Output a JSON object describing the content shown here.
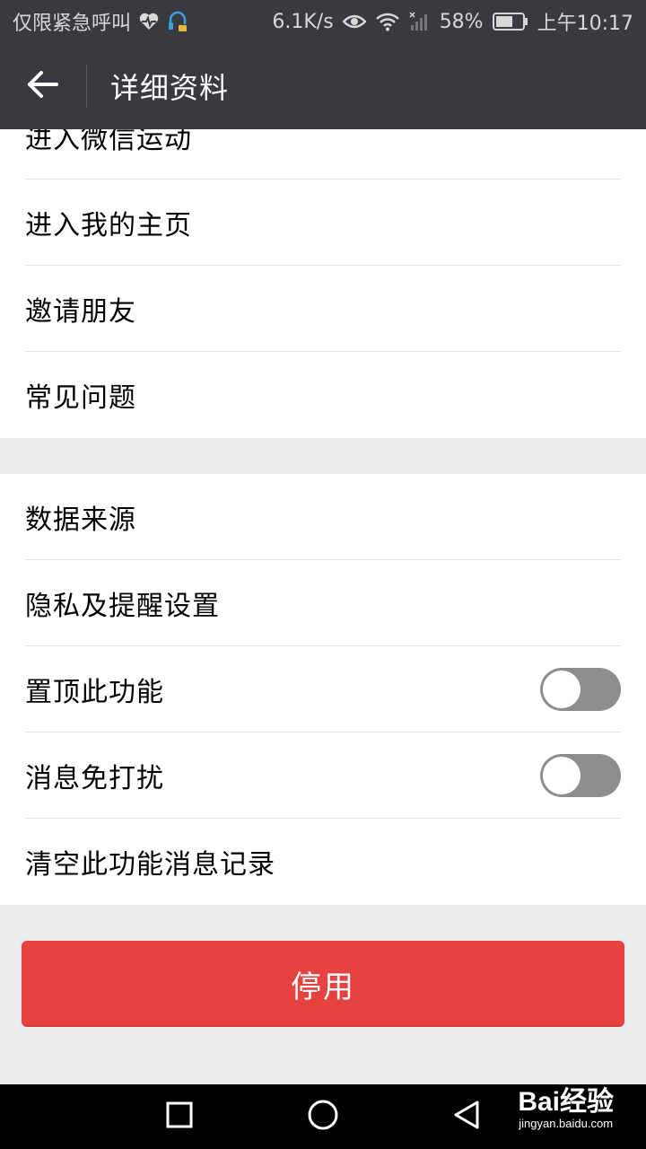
{
  "status_bar": {
    "carrier": "仅限紧急呼叫",
    "net_speed": "6.1K/s",
    "battery": "58%",
    "time": "上午10:17",
    "icons": [
      "heart-rate-icon",
      "headset-icon",
      "eye-icon",
      "wifi-icon",
      "signal-icon",
      "battery-icon"
    ]
  },
  "header": {
    "title": "详细资料",
    "back_icon": "arrow-left-icon"
  },
  "group1": {
    "items": [
      {
        "label": "进入微信运动"
      },
      {
        "label": "进入我的主页"
      },
      {
        "label": "邀请朋友"
      },
      {
        "label": "常见问题"
      }
    ]
  },
  "group2": {
    "items": [
      {
        "label": "数据来源"
      },
      {
        "label": "隐私及提醒设置"
      },
      {
        "label": "置顶此功能",
        "toggle": false
      },
      {
        "label": "消息免打扰",
        "toggle": false
      },
      {
        "label": "清空此功能消息记录"
      }
    ]
  },
  "disable_button": {
    "label": "停用",
    "color": "#e64340"
  },
  "nav_bar": {
    "icons": [
      "recent-apps-icon",
      "home-icon",
      "back-triangle-icon"
    ]
  },
  "watermark": {
    "logo": "Bai经验",
    "url": "jingyan.baidu.com"
  }
}
